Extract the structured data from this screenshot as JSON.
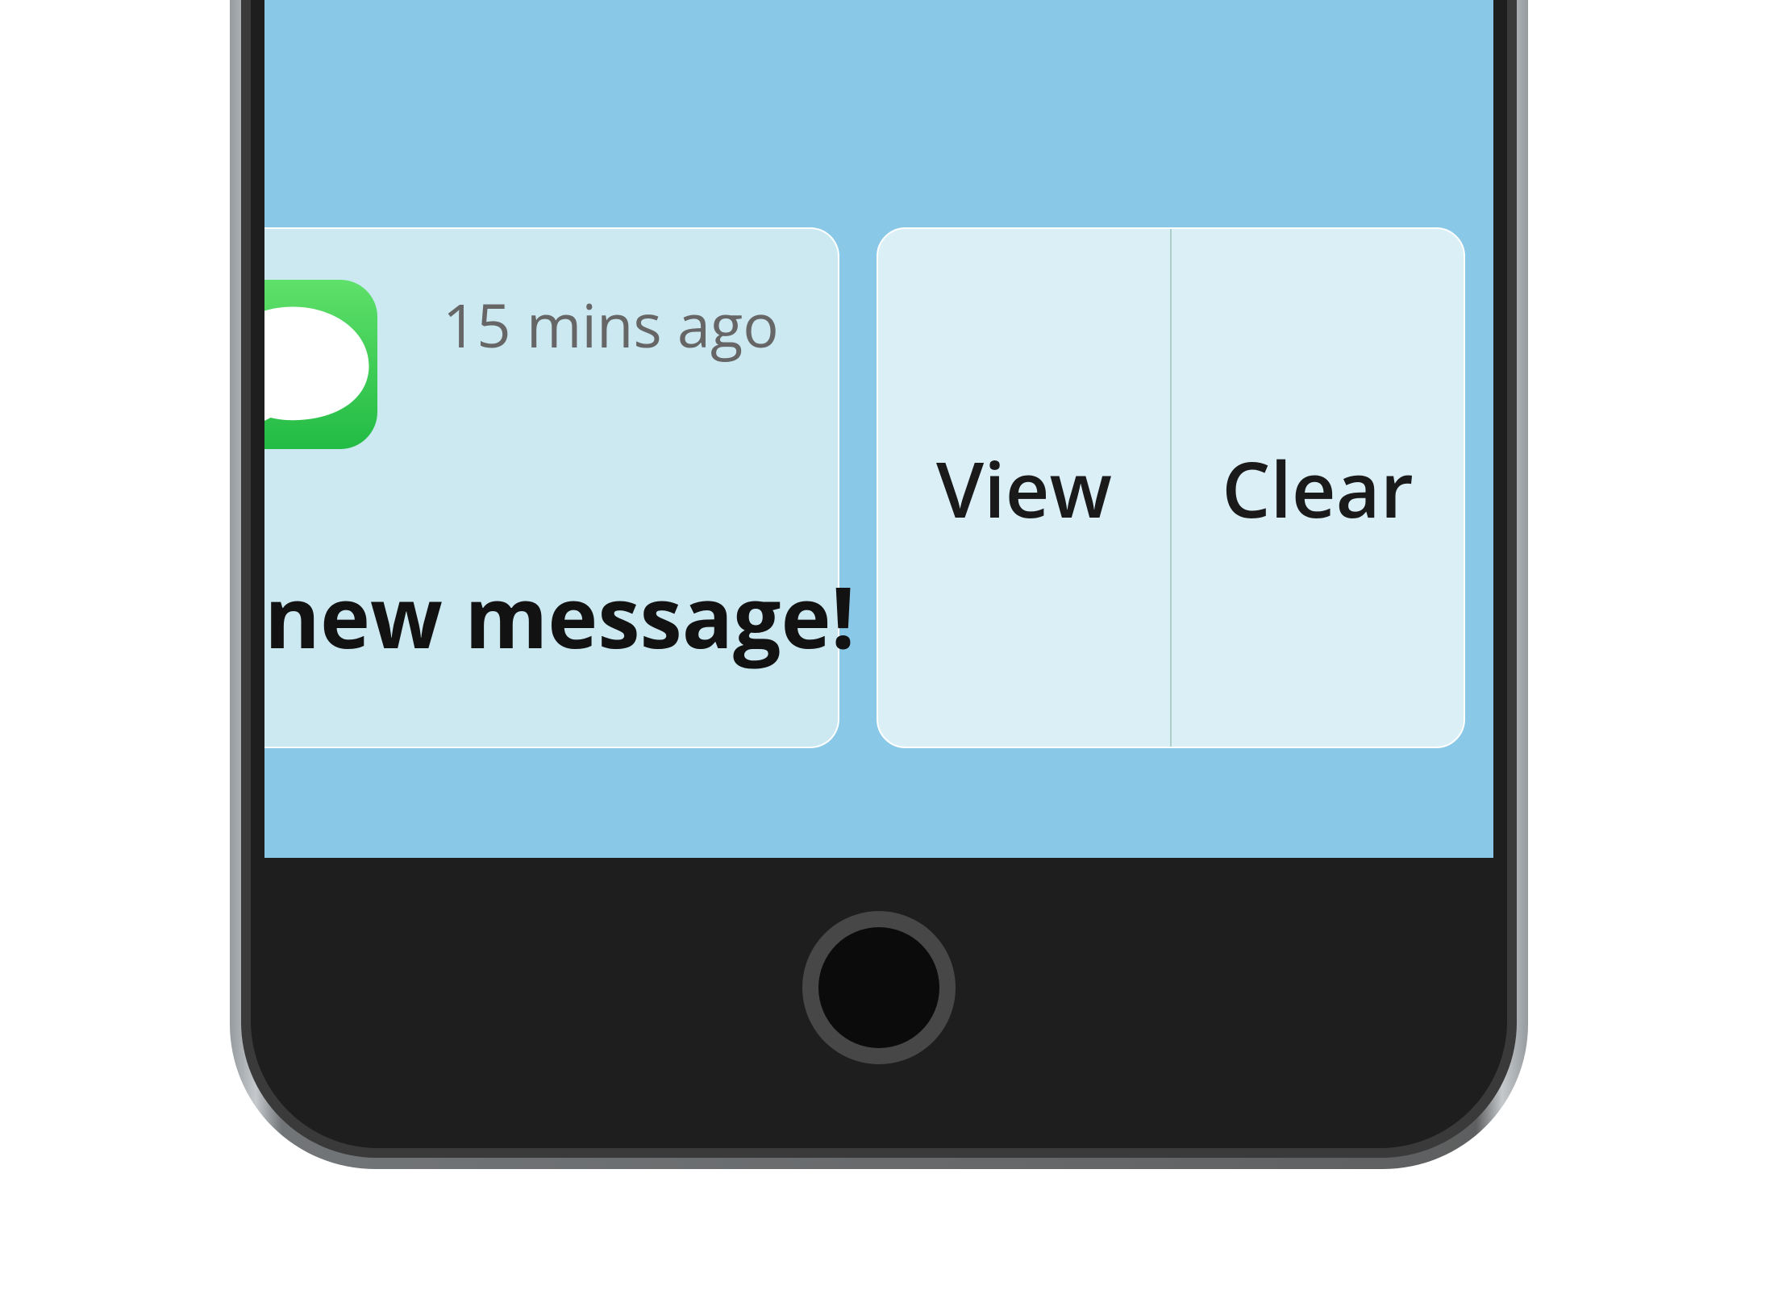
{
  "notification": {
    "app_icon": "messages-icon",
    "timestamp": "15 mins ago",
    "body": "new message!"
  },
  "actions": {
    "view_label": "View",
    "clear_label": "Clear"
  },
  "colors": {
    "screen_bg": "#8ac8e8",
    "card_bg": "#cce9f2",
    "actions_bg": "#dbeff6",
    "icon_gradient_top": "#5fe06a",
    "icon_gradient_bottom": "#22bb44"
  }
}
